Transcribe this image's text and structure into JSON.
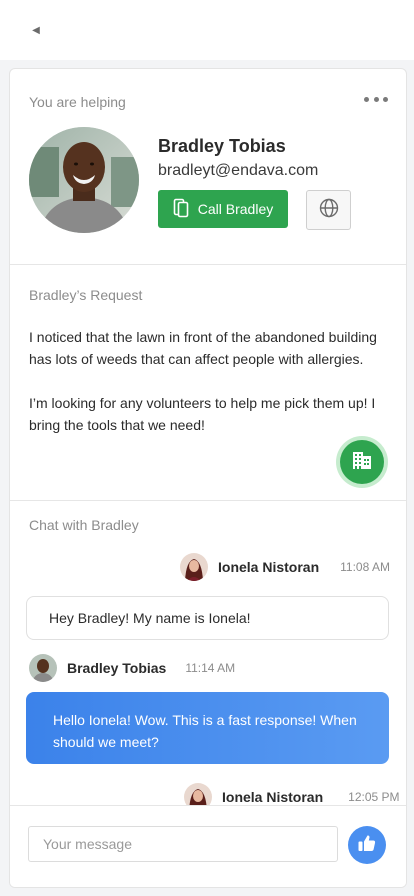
{
  "topbar": {
    "back_icon": "back-arrow-icon"
  },
  "helping": {
    "label": "You are helping",
    "more_icon": "more-dots-icon",
    "user": {
      "name": "Bradley Tobias",
      "email": "bradleyt@endava.com"
    },
    "call_button": {
      "label": "Call Bradley",
      "icon": "phone-icon"
    },
    "globe_button": {
      "icon": "globe-icon"
    }
  },
  "request": {
    "label": "Bradley’s  Request",
    "paragraphs": [
      "I noticed that the lawn in front of the abandoned building has lots of weeds that can affect people with allergies.",
      "I’m looking for any volunteers to help me pick them up! I bring the tools that we need!"
    ],
    "action_icon": "building-icon"
  },
  "chat": {
    "label": "Chat with Bradley",
    "messages": [
      {
        "sender": "Ionela Nistoran",
        "time": "11:08 AM",
        "text": "Hey Bradley! My name is Ionela!"
      },
      {
        "sender": "Bradley Tobias",
        "time": "11:14 AM",
        "text": "Hello Ionela! Wow. This is a fast response! When should we meet?"
      },
      {
        "sender": "Ionela Nistoran",
        "time": "12:05 PM",
        "text": ""
      }
    ]
  },
  "composer": {
    "placeholder": "Your message",
    "send_icon": "thumbs-up-icon"
  },
  "colors": {
    "accent_green": "#2ea44f",
    "accent_blue": "#4a8ff0"
  }
}
